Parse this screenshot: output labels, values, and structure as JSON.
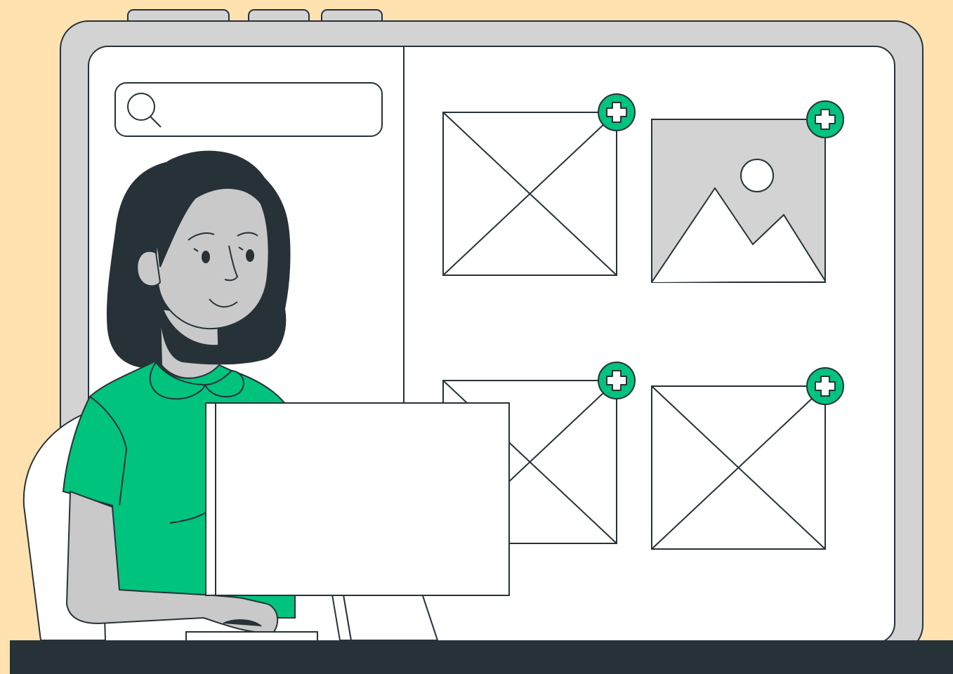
{
  "colors": {
    "background": "#FFE2B0",
    "frame": "#D3D3D3",
    "outline": "#263238",
    "panel": "#FFFFFF",
    "placeholder_fill": "#D3D3D3",
    "accent_green": "#00C37E",
    "hair": "#263238",
    "skin": "#C9C9C9",
    "desk": "#263238"
  },
  "icons": {
    "search": "search-icon",
    "add": "plus-circle-icon",
    "broken_image": "image-placeholder-icon",
    "landscape_image": "mountain-image-icon"
  },
  "search": {
    "placeholder": "",
    "value": ""
  },
  "gallery": {
    "items": [
      {
        "type": "placeholder",
        "action": "add"
      },
      {
        "type": "landscape",
        "action": "add"
      },
      {
        "type": "placeholder",
        "action": "add"
      },
      {
        "type": "placeholder",
        "action": "add"
      }
    ]
  }
}
